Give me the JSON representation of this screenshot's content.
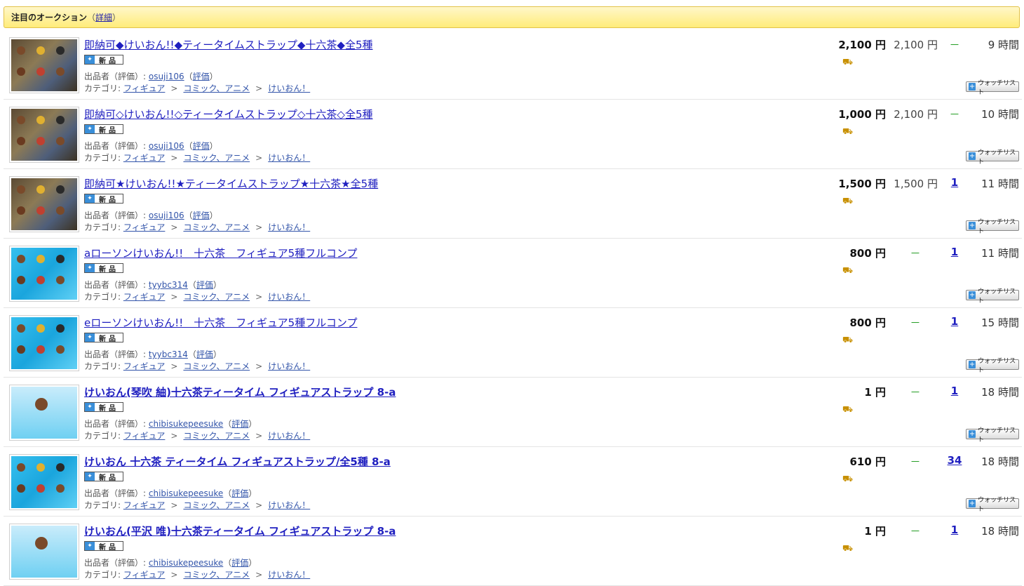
{
  "header": {
    "title": "注目のオークション",
    "paren_open": "（",
    "detail": "詳細",
    "paren_close": "）"
  },
  "labels": {
    "seller_prefix": "出品者（評価）: ",
    "rating_open": "（",
    "rating": "評価",
    "rating_close": "）",
    "category_prefix": "カテゴリ: ",
    "badge": "新品",
    "watch": "ウォッチリスト",
    "separator": ">"
  },
  "items": [
    {
      "title": "即納可◆けいおん!!◆ティータイムストラップ◆十六茶◆全5種",
      "bold": false,
      "price": "2,100 円",
      "buynow": "2,100 円",
      "bids": "－",
      "time": "9 時間",
      "seller": "osuji106",
      "category": [
        "フィギュア",
        "コミック、アニメ",
        "けいおん！"
      ],
      "thumb": "brown"
    },
    {
      "title": "即納可◇けいおん!!◇ティータイムストラップ◇十六茶◇全5種",
      "bold": false,
      "price": "1,000 円",
      "buynow": "2,100 円",
      "bids": "－",
      "time": "10 時間",
      "seller": "osuji106",
      "category": [
        "フィギュア",
        "コミック、アニメ",
        "けいおん！"
      ],
      "thumb": "brown"
    },
    {
      "title": "即納可★けいおん!!★ティータイムストラップ★十六茶★全5種",
      "bold": false,
      "price": "1,500 円",
      "buynow": "1,500 円",
      "bids": "1",
      "time": "11 時間",
      "seller": "osuji106",
      "category": [
        "フィギュア",
        "コミック、アニメ",
        "けいおん！"
      ],
      "thumb": "brown"
    },
    {
      "title": "aローソンけいおん!!　十六茶　フィギュア5種フルコンプ",
      "bold": false,
      "price": "800 円",
      "buynow": "－",
      "bids": "1",
      "time": "11 時間",
      "seller": "tyybc314",
      "category": [
        "フィギュア",
        "コミック、アニメ",
        "けいおん！"
      ],
      "thumb": "blue"
    },
    {
      "title": "eローソンけいおん!!　十六茶　フィギュア5種フルコンプ",
      "bold": false,
      "price": "800 円",
      "buynow": "－",
      "bids": "1",
      "time": "15 時間",
      "seller": "tyybc314",
      "category": [
        "フィギュア",
        "コミック、アニメ",
        "けいおん！"
      ],
      "thumb": "blue"
    },
    {
      "title": "けいおん(琴吹 紬)十六茶ティータイム フィギュアストラップ 8-a",
      "bold": true,
      "price": "1 円",
      "buynow": "－",
      "bids": "1",
      "time": "18 時間",
      "seller": "chibisukepeesuke",
      "category": [
        "フィギュア",
        "コミック、アニメ",
        "けいおん！"
      ],
      "thumb": "single"
    },
    {
      "title": "けいおん 十六茶 ティータイム フィギュアストラップ/全5種 8-a",
      "bold": true,
      "price": "610 円",
      "buynow": "－",
      "bids": "34",
      "time": "18 時間",
      "seller": "chibisukepeesuke",
      "category": [
        "フィギュア",
        "コミック、アニメ",
        "けいおん！"
      ],
      "thumb": "blue"
    },
    {
      "title": "けいおん(平沢 唯)十六茶ティータイム フィギュアストラップ 8-a",
      "bold": true,
      "price": "1 円",
      "buynow": "－",
      "bids": "1",
      "time": "18 時間",
      "seller": "chibisukepeesuke",
      "category": [
        "フィギュア",
        "コミック、アニメ",
        "けいおん！"
      ],
      "thumb": "single"
    }
  ]
}
